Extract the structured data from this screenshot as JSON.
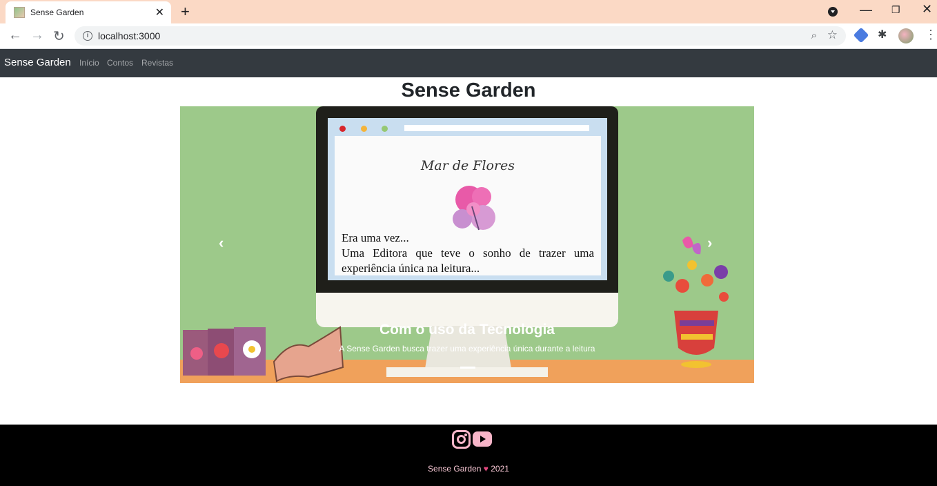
{
  "browser": {
    "tab_title": "Sense Garden",
    "tab_close": "✕",
    "new_tab": "+",
    "url": "localhost:3000",
    "back": "←",
    "forward": "→",
    "reload": "↻",
    "info": "i",
    "zoom_icon": "⌕",
    "star_icon": "☆",
    "extensions_icon": "✱",
    "menu": "⋮",
    "minimize": "—",
    "maximize": "❐",
    "close": "✕"
  },
  "navbar": {
    "brand": "Sense Garden",
    "links": [
      "Início",
      "Contos",
      "Revistas"
    ]
  },
  "main": {
    "title": "Sense Garden"
  },
  "carousel": {
    "slide": {
      "screen_title": "Mar de Flores",
      "story_lines": [
        "Era uma vez...",
        "Uma Editora que teve o sonho de trazer uma experiência única na leitura..."
      ],
      "caption_title": "Com o uso da Tecnologia",
      "caption_text": "A Sense Garden busca trazer uma experiência única durante a leitura"
    },
    "prev": "‹",
    "next": "›",
    "slide_count": 3,
    "active_slide": 2
  },
  "footer": {
    "brand": "Sense Garden",
    "heart": "♥",
    "year": "2021",
    "social": [
      "instagram-icon",
      "youtube-icon"
    ]
  },
  "colors": {
    "navbar": "#343a40",
    "carousel_bg": "#9dc98a",
    "footer_bg": "#000000",
    "accent_pink": "#f7b5c8"
  }
}
